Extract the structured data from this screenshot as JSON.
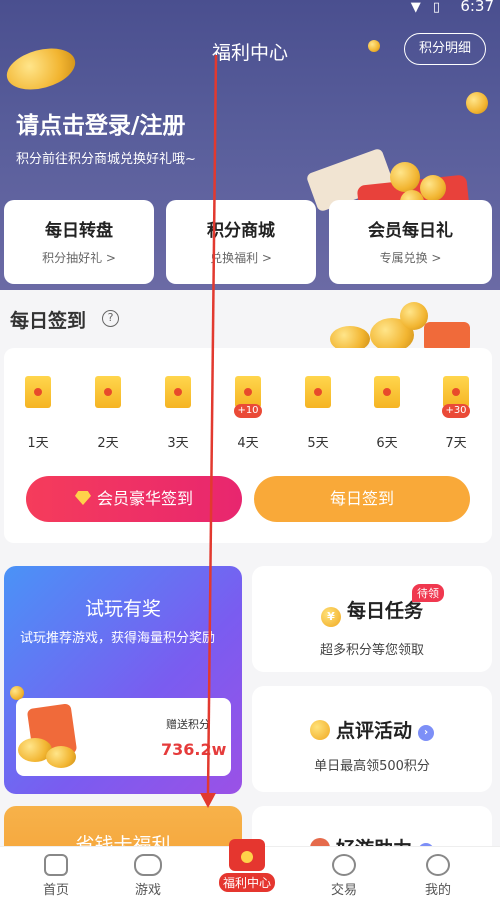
{
  "status": {
    "time": "6:37"
  },
  "header": {
    "title": "福利中心",
    "detail_button": "积分明细"
  },
  "login": {
    "title": "请点击登录/注册",
    "subtitle": "积分前往积分商城兑换好礼哦~"
  },
  "quick_cards": [
    {
      "title": "每日转盘",
      "subtitle": "积分抽好礼 >"
    },
    {
      "title": "积分商城",
      "subtitle": "兑换福利 >"
    },
    {
      "title": "会员每日礼",
      "subtitle": "专属兑换 >"
    }
  ],
  "signin": {
    "title": "每日签到",
    "days": [
      {
        "label": "1天",
        "bonus": ""
      },
      {
        "label": "2天",
        "bonus": ""
      },
      {
        "label": "3天",
        "bonus": ""
      },
      {
        "label": "4天",
        "bonus": "+10"
      },
      {
        "label": "5天",
        "bonus": ""
      },
      {
        "label": "6天",
        "bonus": ""
      },
      {
        "label": "7天",
        "bonus": "+30"
      }
    ],
    "vip_button": "会员豪华签到",
    "daily_button": "每日签到"
  },
  "trial": {
    "title": "试玩有奖",
    "desc": "试玩推荐游戏，获得海量积分奖励",
    "gift_label": "赠送积分",
    "gift_value": "736.2w"
  },
  "daily_task": {
    "title": "每日任务",
    "subtitle": "超多积分等您领取",
    "badge": "待领"
  },
  "review": {
    "title": "点评活动",
    "subtitle": "单日最高领500积分"
  },
  "saver_card": {
    "title": "省钱卡福利"
  },
  "help_card": {
    "title": "好游助力"
  },
  "nav": [
    {
      "label": "首页"
    },
    {
      "label": "游戏"
    },
    {
      "label": "福利中心"
    },
    {
      "label": "交易"
    },
    {
      "label": "我的"
    }
  ],
  "colors": {
    "hero": "#4a4f8f",
    "accent_red": "#e5362f",
    "orange": "#f9a939",
    "pink": "#f53c5b"
  }
}
